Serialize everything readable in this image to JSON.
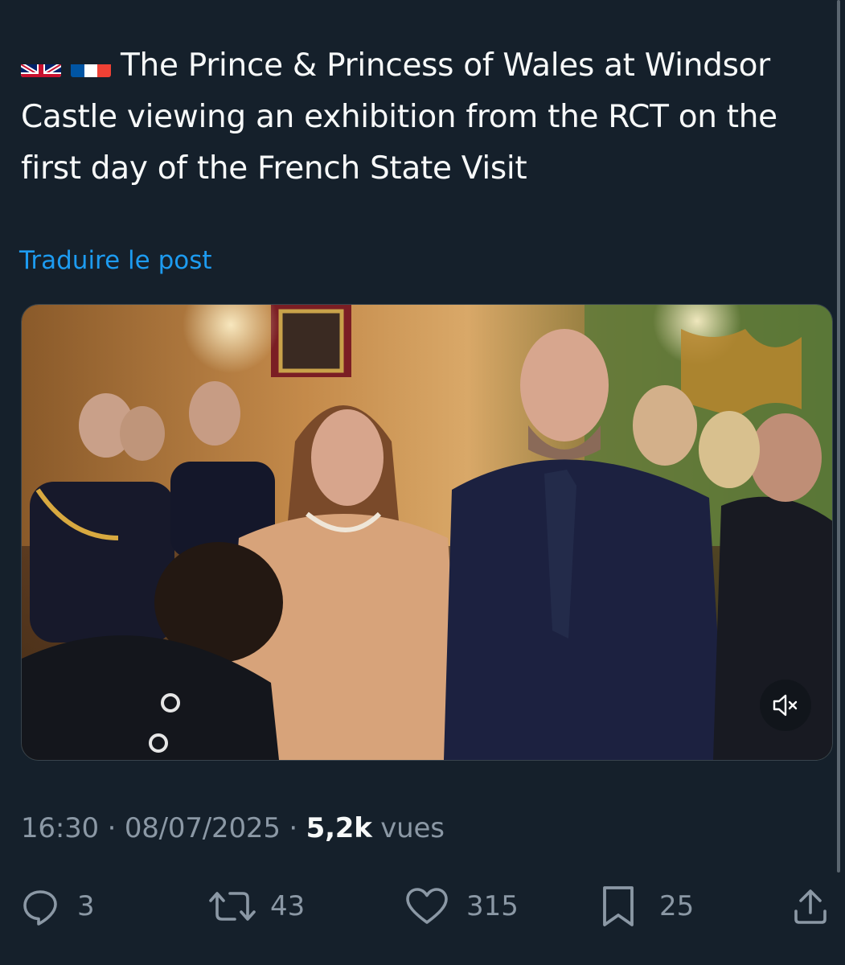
{
  "post": {
    "flags": [
      "uk-flag-icon",
      "france-flag-icon"
    ],
    "text": "The Prince & Princess of Wales at Windsor Castle viewing an exhibition from the RCT on the first day of the French State Visit",
    "translate_label": "Traduire le post"
  },
  "media": {
    "type": "video",
    "mute_icon": "speaker-muted-icon"
  },
  "meta": {
    "time": "16:30",
    "sep1": "·",
    "date": "08/07/2025",
    "sep2": "·",
    "views_count": "5,2k",
    "views_label": "vues"
  },
  "actions": {
    "replies": "3",
    "reposts": "43",
    "likes": "315",
    "bookmarks": "25"
  },
  "colors": {
    "background": "#15202b",
    "text": "#f7f9f9",
    "secondary": "#8b98a5",
    "link": "#1d9bf0"
  }
}
